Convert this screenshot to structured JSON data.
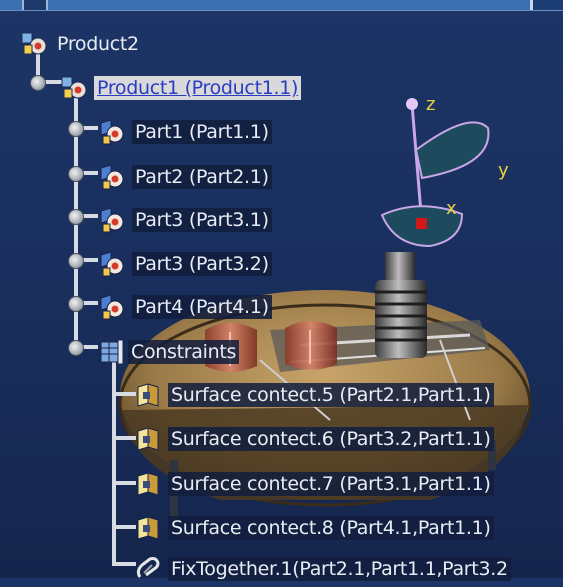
{
  "tree": {
    "root": {
      "label": "Product2",
      "icon": "product-icon"
    },
    "product": {
      "label": "Product1 (Product1.1)",
      "icon": "product-icon",
      "selected": true
    },
    "parts": [
      {
        "label": "Part1 (Part1.1)",
        "icon": "part-icon"
      },
      {
        "label": "Part2 (Part2.1)",
        "icon": "part-icon"
      },
      {
        "label": "Part3 (Part3.1)",
        "icon": "part-icon"
      },
      {
        "label": "Part3 (Part3.2)",
        "icon": "part-icon"
      },
      {
        "label": "Part4 (Part4.1)",
        "icon": "part-icon"
      }
    ],
    "constraints": {
      "label": "Constraints",
      "icon": "constraints-icon",
      "items": [
        {
          "label": "Surface contect.5 (Part2.1,Part1.1)",
          "icon": "surface-contact-icon"
        },
        {
          "label": "Surface contect.6 (Part3.2,Part1.1)",
          "icon": "surface-contact-icon"
        },
        {
          "label": "Surface contect.7 (Part3.1,Part1.1)",
          "icon": "surface-contact-icon"
        },
        {
          "label": "Surface contect.8 (Part4.1,Part1.1)",
          "icon": "surface-contact-icon"
        },
        {
          "label": "FixTogether.1(Part2.1,Part1.1,Part3.2",
          "icon": "fix-together-icon"
        }
      ]
    }
  },
  "compass": {
    "axes": [
      "z",
      "y",
      "x"
    ]
  },
  "colors": {
    "background": "#1a2f5e",
    "selection_bg": "#d9d9dc",
    "selection_text": "#2a3cc0",
    "compass": "#c9a6e8",
    "axis_label": "#e8d23a",
    "compass_origin": "#d01818",
    "part_body": "#8a6a3c"
  }
}
